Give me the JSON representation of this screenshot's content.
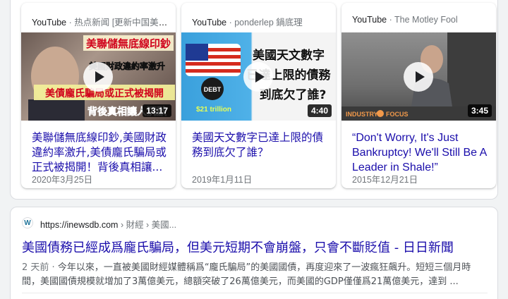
{
  "videos": [
    {
      "source": "YouTube",
      "separator": " · ",
      "channel": "热点新闻 [更新中国美国...",
      "duration": "13:17",
      "thumb_text": [
        "美聯儲無底線印鈔",
        "美國財政違約率激升",
        "美債龐氏騙局或正式被揭開",
        "背後真相讓人沉默"
      ],
      "title": "美聯儲無底線印鈔,美國財政違約率激升,美債龐氏騙局或正式被揭開！背後真相讓...",
      "date": "2020年3月25日"
    },
    {
      "source": "YouTube",
      "separator": " · ",
      "channel": "ponderlep 鍋底理",
      "duration": "4:40",
      "thumb_text": [
        "美國天文數字",
        "已達上限的債務",
        "到底欠了誰?",
        "DEBT",
        "$21 trillion"
      ],
      "title": "美國天文數字已達上限的債務到底欠了誰？",
      "date": "2019年1月11日"
    },
    {
      "source": "YouTube",
      "separator": " · ",
      "channel": "The Motley Fool",
      "duration": "3:45",
      "thumb_text": [
        "INDUSTRY",
        "FOCUS"
      ],
      "title": "“Don't Worry, It's Just Bankruptcy! We'll Still Be A Leader in Shale!”",
      "date": "2015年12月21日"
    }
  ],
  "result": {
    "favicon": "W",
    "url_domain": "https://inewsdb.com",
    "url_crumbs": " › 財經 › 美國...",
    "title": "美國債務已經成爲龐氏騙局，但美元短期不會崩盤，只會不斷貶值 - 日日新聞",
    "snippet_meta": "2 天前 · ",
    "snippet": "今年以來，一直被美國財經媒體稱爲“龐氏騙局”的美國國債，再度迎來了一波瘋狂飆升。短短三個月時間，美國國債規模就增加了3萬億美元，總額突破了26萬億美元，而美國的GDP僅僅爲21萬億美元，達到 ..."
  },
  "colors": {
    "link": "#1a0dab",
    "meta": "#70757a",
    "snippet": "#4d5156",
    "background": "#f1f3f4"
  }
}
